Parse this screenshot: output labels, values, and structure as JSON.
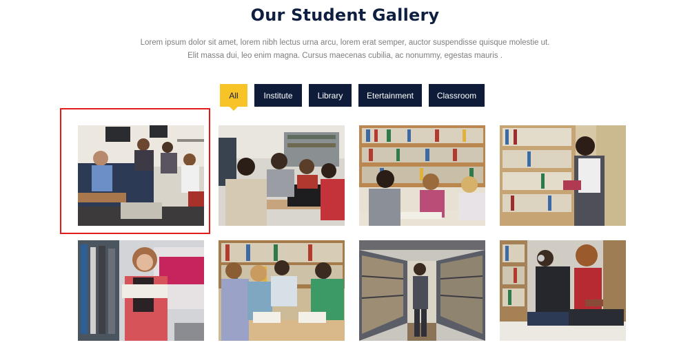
{
  "gallery": {
    "title": "Our Student Gallery",
    "description_line1": "Lorem ipsum dolor sit amet, lorem nibh lectus urna arcu, lorem erat semper, auctor suspendisse quisque molestie ut.",
    "description_line2": "Elit massa dui, leo enim magna. Cursus maecenas cubilia, ac nonummy, egestas mauris ."
  },
  "filters": [
    {
      "label": "All",
      "active": true
    },
    {
      "label": "Institute",
      "active": false
    },
    {
      "label": "Library",
      "active": false
    },
    {
      "label": "Etertainment",
      "active": false
    },
    {
      "label": "Classroom",
      "active": false
    }
  ],
  "colors": {
    "heading": "#0e1f3f",
    "filter_bg": "#0e1c39",
    "filter_active": "#f7c326",
    "selection": "#e21a1a"
  },
  "photos": [
    {
      "subject": "students-booth-study",
      "selected": true
    },
    {
      "subject": "students-laptop-table",
      "selected": false
    },
    {
      "subject": "students-library-reading",
      "selected": false
    },
    {
      "subject": "student-reading-shelves",
      "selected": false
    },
    {
      "subject": "student-smiling-book",
      "selected": false
    },
    {
      "subject": "students-group-study",
      "selected": false
    },
    {
      "subject": "student-library-aisle",
      "selected": false
    },
    {
      "subject": "students-floor-reading",
      "selected": false
    }
  ]
}
